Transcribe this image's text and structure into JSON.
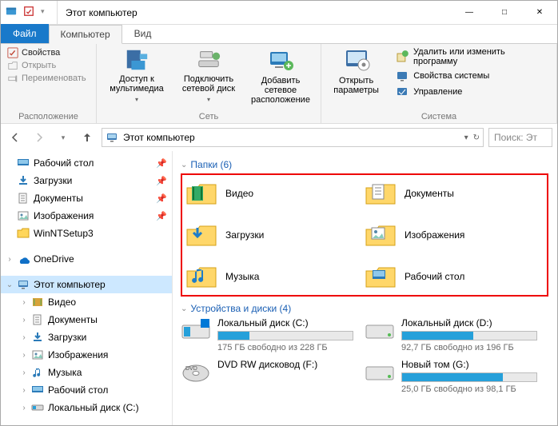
{
  "titlebar": {
    "title": "Этот компьютер"
  },
  "win_controls": {
    "min": "—",
    "max": "□",
    "close": "✕"
  },
  "tabs": {
    "file": "Файл",
    "computer": "Компьютер",
    "view": "Вид"
  },
  "ribbon": {
    "location": {
      "label": "Расположение",
      "properties": "Свойства",
      "open": "Открыть",
      "rename": "Переименовать"
    },
    "network": {
      "label": "Сеть",
      "media": "Доступ к мультимедиа",
      "mapdrive": "Подключить сетевой диск",
      "addloc": "Добавить сетевое расположение"
    },
    "sys": {
      "settings": "Открыть параметры",
      "uninstall": "Удалить или изменить программу",
      "props": "Свойства системы",
      "mgmt": "Управление",
      "label": "Система"
    }
  },
  "address": {
    "path": "Этот компьютер",
    "search_placeholder": "Поиск: Эт"
  },
  "nav": {
    "desktop": "Рабочий стол",
    "downloads": "Загрузки",
    "documents": "Документы",
    "pictures": "Изображения",
    "winnt": "WinNTSetup3",
    "onedrive": "OneDrive",
    "thispc": "Этот компьютер",
    "video": "Видео",
    "docs2": "Документы",
    "dl2": "Загрузки",
    "pics2": "Изображения",
    "music2": "Музыка",
    "desk2": "Рабочий стол",
    "drive_c": "Локальный диск (C:)"
  },
  "content": {
    "folders_header": "Папки (6)",
    "drives_header": "Устройства и диски (4)",
    "folders": {
      "video": "Видео",
      "documents": "Документы",
      "downloads": "Загрузки",
      "pictures": "Изображения",
      "music": "Музыка",
      "desktop": "Рабочий стол"
    },
    "drives": {
      "c": {
        "name": "Локальный диск (C:)",
        "free": "175 ГБ свободно из 228 ГБ",
        "used_pct": 23
      },
      "d": {
        "name": "Локальный диск (D:)",
        "free": "92,7 ГБ свободно из 196 ГБ",
        "used_pct": 53
      },
      "f": {
        "name": "DVD RW дисковод (F:)",
        "free": ""
      },
      "g": {
        "name": "Новый том (G:)",
        "free": "25,0 ГБ свободно из 98,1 ГБ",
        "used_pct": 75
      }
    }
  }
}
